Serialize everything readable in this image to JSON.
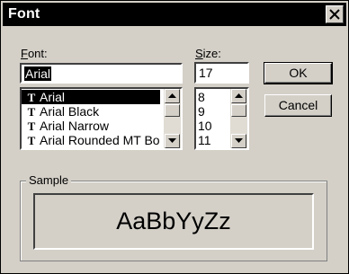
{
  "window": {
    "title": "Font"
  },
  "font": {
    "label_prefix": "",
    "label_underline": "F",
    "label_rest": "ont:",
    "value": "Arial",
    "items": [
      {
        "name": "Arial",
        "icon": "truetype-icon",
        "selected": true
      },
      {
        "name": "Arial Black",
        "icon": "truetype-icon",
        "selected": false
      },
      {
        "name": "Arial Narrow",
        "icon": "truetype-icon",
        "selected": false
      },
      {
        "name": "Arial Rounded MT Bo",
        "icon": "truetype-icon",
        "selected": false
      }
    ]
  },
  "size": {
    "label_underline": "S",
    "label_rest": "ize:",
    "value": "17",
    "items": [
      "8",
      "9",
      "10",
      "11"
    ]
  },
  "buttons": {
    "ok": "OK",
    "cancel": "Cancel"
  },
  "sample": {
    "label": "Sample",
    "text": "AaBbYyZz"
  },
  "icons": {
    "truetype_glyph": "T"
  }
}
